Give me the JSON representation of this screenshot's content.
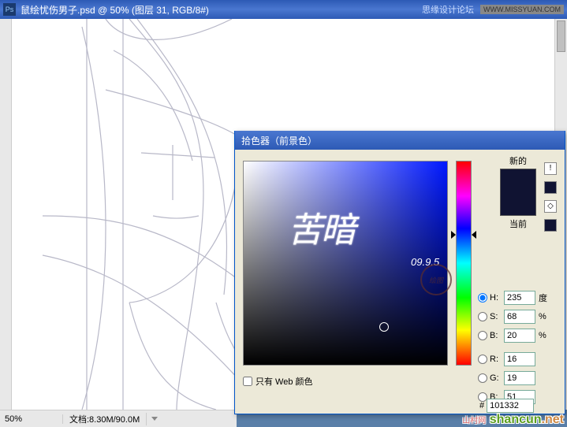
{
  "titlebar": {
    "icon_text": "Ps",
    "title": "鼠绘忧伤男子.psd @ 50% (图层 31, RGB/8#)",
    "watermark1": "思缘设计论坛",
    "watermark2": "WWW.MISSYUAN.COM"
  },
  "statusbar": {
    "zoom": "50%",
    "doc": "文档:8.30M/90.0M"
  },
  "colorpicker": {
    "title": "拾色器（前景色）",
    "new_label": "新的",
    "current_label": "当前",
    "web_only_label": "只有 Web 颜色",
    "hsb": {
      "h_label": "H:",
      "h_value": "235",
      "h_unit": "度",
      "s_label": "S:",
      "s_value": "68",
      "s_unit": "%",
      "b_label": "B:",
      "b_value": "20",
      "b_unit": "%"
    },
    "rgb": {
      "r_label": "R:",
      "r_value": "16",
      "g_label": "G:",
      "g_value": "19",
      "b_label": "B:",
      "b_value": "51"
    },
    "hex_label": "#",
    "hex_value": "101332",
    "warn_icon": "!"
  },
  "signature": {
    "main": "苦暗",
    "date": "09.9.5",
    "stamp": "绘图"
  },
  "footer_watermark": {
    "brand": "shancun",
    "tld": ".net",
    "tag": "山村网"
  }
}
